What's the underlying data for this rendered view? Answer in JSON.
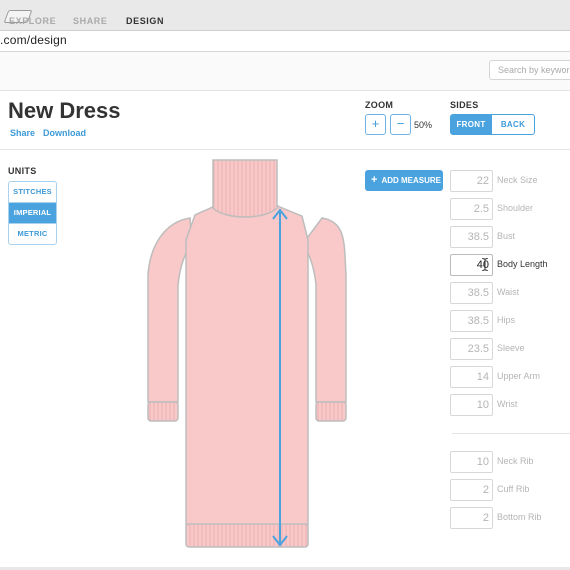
{
  "url": ".com/design",
  "nav": {
    "explore": "EXPLORE",
    "share": "SHARE",
    "design": "DESIGN"
  },
  "search": {
    "placeholder": "Search by keyword"
  },
  "design": {
    "title": "New Dress",
    "share_link": "Share",
    "download_link": "Download"
  },
  "zoom": {
    "label": "ZOOM",
    "plus": "+",
    "minus": "−",
    "value": "50%"
  },
  "sides": {
    "label": "SIDES",
    "front": "FRONT",
    "back": "BACK",
    "selected": "FRONT"
  },
  "units": {
    "label": "UNITS",
    "options": [
      "STITCHES",
      "IMPERIAL",
      "METRIC"
    ],
    "selected": "IMPERIAL"
  },
  "add_measure": {
    "label": "ADD MEASURE"
  },
  "measures": [
    {
      "value": "22",
      "label": "Neck Size"
    },
    {
      "value": "2.5",
      "label": "Shoulder"
    },
    {
      "value": "38.5",
      "label": "Bust"
    },
    {
      "value": "40",
      "label": "Body Length",
      "active": true
    },
    {
      "value": "38.5",
      "label": "Waist"
    },
    {
      "value": "38.5",
      "label": "Hips"
    },
    {
      "value": "23.5",
      "label": "Sleeve"
    },
    {
      "value": "14",
      "label": "Upper Arm"
    },
    {
      "value": "10",
      "label": "Wrist"
    }
  ],
  "rib_measures": [
    {
      "value": "10",
      "label": "Neck Rib"
    },
    {
      "value": "2",
      "label": "Cuff Rib"
    },
    {
      "value": "2",
      "label": "Bottom Rib"
    }
  ],
  "colors": {
    "accent": "#4aa3df",
    "garment_fill": "#f9c8c8",
    "garment_outline": "#bdbdbd",
    "measure_line": "#4aa3df"
  },
  "icons": {
    "tab": "browser-tab-icon",
    "plus": "plus-icon",
    "minus": "minus-icon",
    "cursor": "text-cursor-icon"
  }
}
